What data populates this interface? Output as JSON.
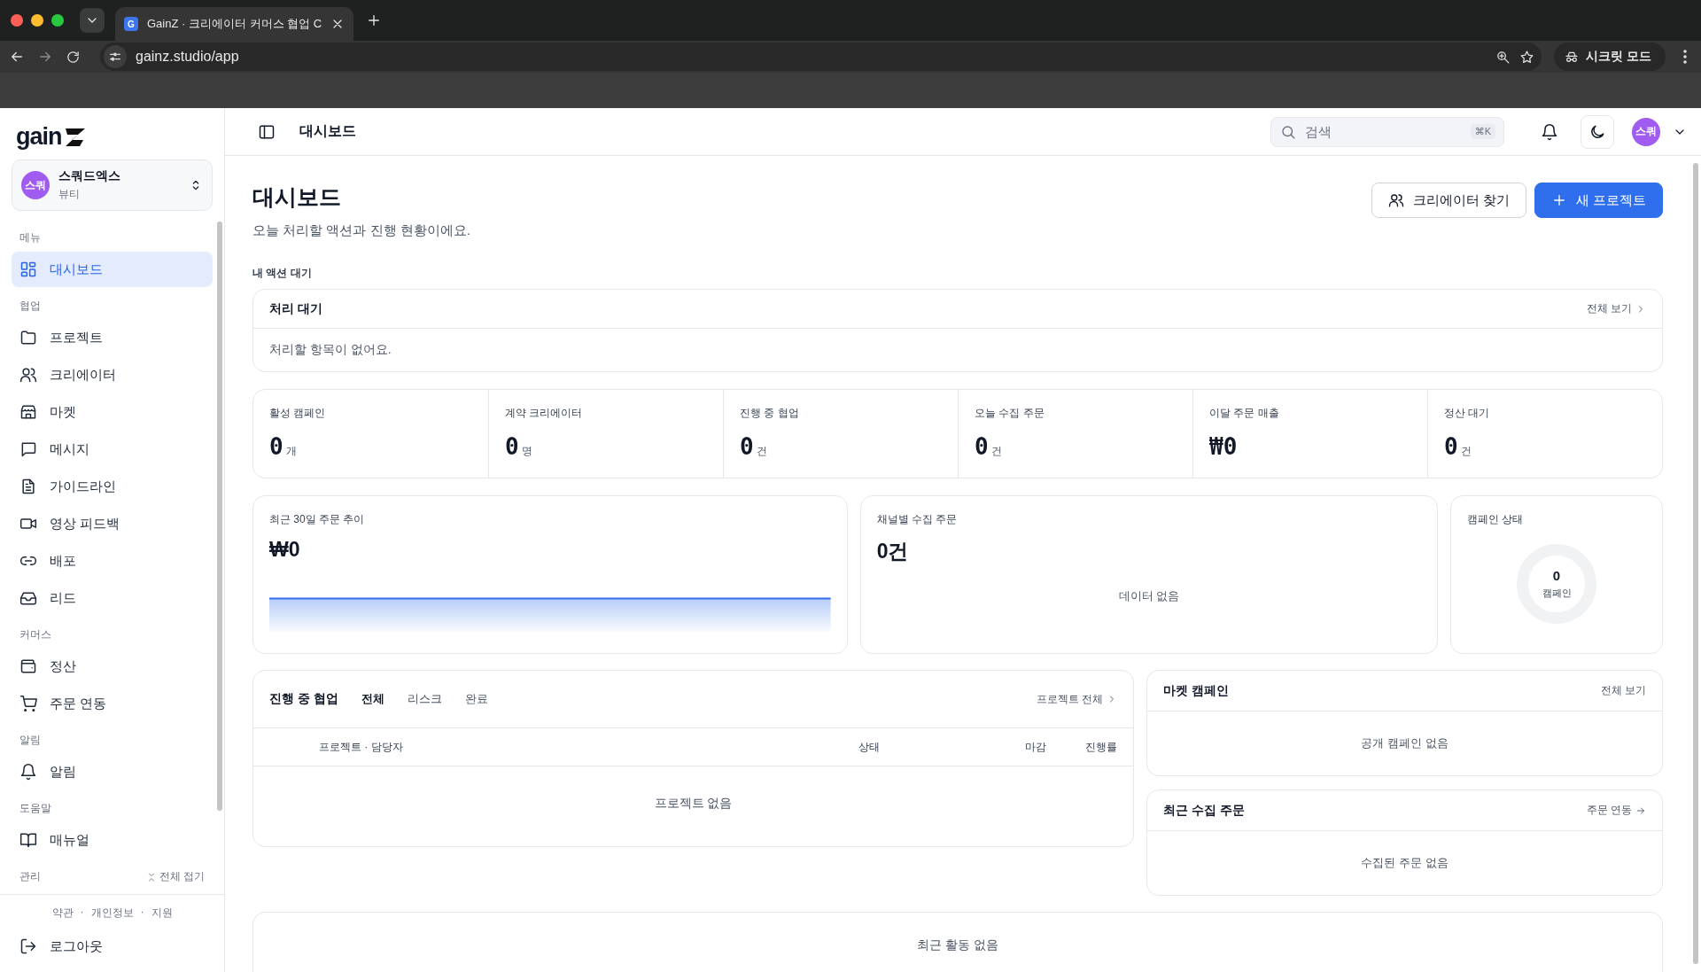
{
  "browser": {
    "tab_title": "GainZ · 크리에이터 커머스 협업 C",
    "favicon": "G",
    "url": "gainz.studio/app",
    "profile": "시크릿 모드"
  },
  "sidebar": {
    "logo": "gain",
    "workspace": {
      "avatar": "스쿼",
      "name": "스쿼드엑스",
      "category": "뷰티"
    },
    "sections": [
      {
        "label": "메뉴",
        "items": [
          {
            "label": "대시보드",
            "selected": true
          }
        ]
      },
      {
        "label": "협업",
        "items": [
          {
            "label": "프로젝트",
            "selected": false
          },
          {
            "label": "크리에이터",
            "selected": false
          },
          {
            "label": "마켓",
            "selected": false
          },
          {
            "label": "메시지",
            "selected": false
          },
          {
            "label": "가이드라인",
            "selected": false
          },
          {
            "label": "영상 피드백",
            "selected": false
          },
          {
            "label": "배포",
            "selected": false
          },
          {
            "label": "리드",
            "selected": false
          }
        ]
      },
      {
        "label": "커머스",
        "items": [
          {
            "label": "정산",
            "selected": false
          },
          {
            "label": "주문 연동",
            "selected": false
          }
        ]
      },
      {
        "label": "알림",
        "items": [
          {
            "label": "알림",
            "selected": false
          }
        ]
      },
      {
        "label": "도움말",
        "items": [
          {
            "label": "매뉴얼",
            "selected": false
          }
        ]
      },
      {
        "label": "관리",
        "action": "전체 접기"
      }
    ],
    "footer": {
      "links": [
        "약관",
        "개인정보",
        "지원"
      ],
      "separator": "·",
      "logout": "로그아웃"
    }
  },
  "header": {
    "title": "대시보드",
    "search_placeholder": "검색",
    "shortcut": "⌘K",
    "avatar": "스쿼"
  },
  "page": {
    "title": "대시보드",
    "subtitle": "오늘 처리할 액션과 진행 현황이에요.",
    "buttons": [
      {
        "label": "크리에이터 찾기",
        "kind": "secondary"
      },
      {
        "label": "새 프로젝트",
        "kind": "primary"
      }
    ]
  },
  "action_queue": {
    "label": "내 액션 대기",
    "title": "처리 대기",
    "link": "전체 보기",
    "empty": "처리할 항목이 없어요."
  },
  "stats": [
    {
      "label": "활성 캠페인",
      "value": "0",
      "unit": "개"
    },
    {
      "label": "계약 크리에이터",
      "value": "0",
      "unit": "명"
    },
    {
      "label": "진행 중 협업",
      "value": "0",
      "unit": "건"
    },
    {
      "label": "오늘 수집 주문",
      "value": "0",
      "unit": "건"
    },
    {
      "label": "이달 주문 매출",
      "value": "₩0"
    },
    {
      "label": "정산 대기",
      "value": "0",
      "unit": "건"
    }
  ],
  "trend": {
    "title": "최근 30일 주문 추이",
    "value": "₩0"
  },
  "channels": {
    "title": "채널별 수집 주문",
    "value": "0건",
    "empty": "데이터 없음"
  },
  "campaign_status": {
    "title": "캠페인 상태",
    "value": "0",
    "unit": "캠페인"
  },
  "collaborations": {
    "title": "진행 중 협업",
    "tabs": [
      {
        "label": "전체",
        "selected": true
      },
      {
        "label": "리스크",
        "selected": false
      },
      {
        "label": "완료",
        "selected": false
      }
    ],
    "link": "프로젝트 전체",
    "columns": [
      "프로젝트 · 담당자",
      "상태",
      "마감",
      "진행률"
    ],
    "empty": "프로젝트 없음"
  },
  "market_campaigns": {
    "title": "마켓 캠페인",
    "link": "전체 보기",
    "empty": "공개 캠페인 없음"
  },
  "recent_orders": {
    "title": "최근 수집 주문",
    "link": "주문 연동",
    "empty": "수집된 주문 없음"
  },
  "activity": {
    "empty": "최근 활동 없음"
  }
}
